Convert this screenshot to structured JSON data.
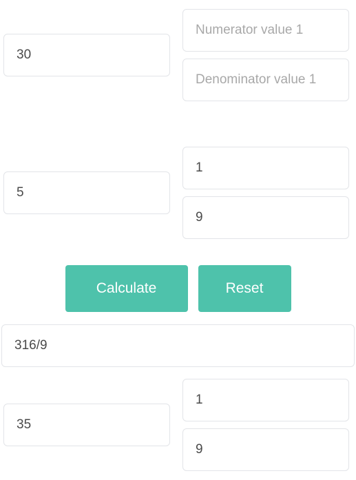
{
  "input1": {
    "whole": "30",
    "numerator_placeholder": "Numerator value 1",
    "numerator_value": "",
    "denominator_placeholder": "Denominator value 1",
    "denominator_value": ""
  },
  "input2": {
    "whole": "5",
    "numerator": "1",
    "denominator": "9"
  },
  "buttons": {
    "calculate": "Calculate",
    "reset": "Reset"
  },
  "result": {
    "fraction_text": "316/9",
    "whole": "35",
    "numerator": "1",
    "denominator": "9"
  }
}
